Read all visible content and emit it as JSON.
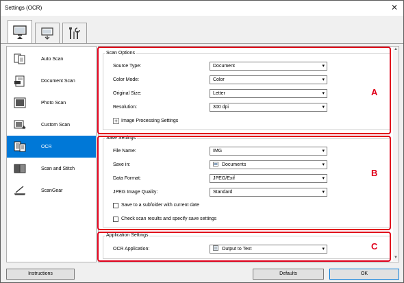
{
  "window": {
    "title": "Settings (OCR)",
    "close_label": "✕"
  },
  "tabs": [
    {
      "name": "scan-from-computer",
      "active": true
    },
    {
      "name": "scan-from-operation-panel",
      "active": false
    },
    {
      "name": "general-settings",
      "active": false
    }
  ],
  "modes": [
    {
      "label": "Auto Scan"
    },
    {
      "label": "Document Scan"
    },
    {
      "label": "Photo Scan"
    },
    {
      "label": "Custom Scan"
    },
    {
      "label": "OCR"
    },
    {
      "label": "Scan and Stitch"
    },
    {
      "label": "ScanGear"
    }
  ],
  "scan_options": {
    "title": "Scan Options",
    "source_type": {
      "label": "Source Type:",
      "value": "Document"
    },
    "color_mode": {
      "label": "Color Mode:",
      "value": "Color"
    },
    "original_size": {
      "label": "Original Size:",
      "value": "Letter"
    },
    "resolution": {
      "label": "Resolution:",
      "value": "300 dpi"
    },
    "image_processing": {
      "toggle": "+",
      "label": "Image Processing Settings"
    }
  },
  "save_settings": {
    "title": "Save Settings",
    "file_name": {
      "label": "File Name:",
      "value": "IMG"
    },
    "save_in": {
      "label": "Save in:",
      "value": "Documents"
    },
    "data_format": {
      "label": "Data Format:",
      "value": "JPEG/Exif"
    },
    "jpeg_quality": {
      "label": "JPEG Image Quality:",
      "value": "Standard"
    },
    "subfolder": {
      "label": "Save to a subfolder with current date"
    },
    "check_results": {
      "label": "Check scan results and specify save settings"
    }
  },
  "application_settings": {
    "title": "Application Settings",
    "ocr_application": {
      "label": "OCR Application:",
      "value": "Output to Text"
    }
  },
  "markers": {
    "a": "A",
    "b": "B",
    "c": "C"
  },
  "buttons": {
    "instructions": "Instructions",
    "defaults": "Defaults",
    "ok": "OK"
  },
  "colors": {
    "selected": "#0078d7",
    "frame": "#e0001b"
  }
}
